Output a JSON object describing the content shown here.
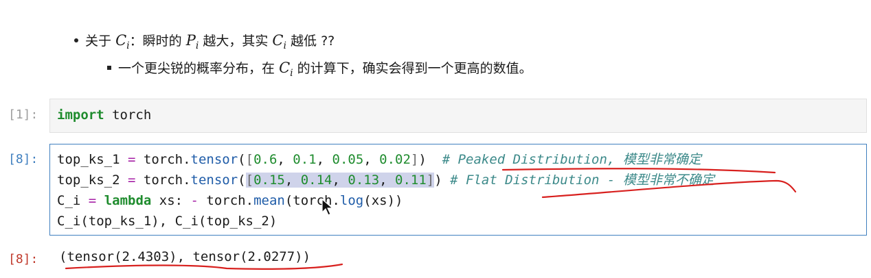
{
  "markdown": {
    "bullet1": {
      "prefix": "关于",
      "sep": "：瞬时的",
      "mid": "越大，其实",
      "suffix": "越低 ??"
    },
    "bullet2": {
      "prefix": "一个更尖锐的概率分布，在",
      "suffix": "的计算下，确实会得到一个更高的数值。"
    },
    "symbols": {
      "C": "C",
      "P": "P",
      "i": "i"
    }
  },
  "cells": [
    {
      "prompt": "[1]:",
      "code": {
        "kw": "import",
        "rest": " torch"
      }
    },
    {
      "prompt": "[8]:",
      "lines": {
        "l1": {
          "var": "top_ks_1",
          "eq": "=",
          "mod": "torch.",
          "fn": "tensor",
          "open": "(",
          "lb": "[",
          "n1": "0.6",
          "c1": ", ",
          "n2": "0.1",
          "c2": ", ",
          "n3": "0.05",
          "c3": ", ",
          "n4": "0.02",
          "rb": "]",
          "close": ")",
          "comment": "# Peaked Distribution, 模型非常确定"
        },
        "l2": {
          "var": "top_ks_2",
          "eq": "=",
          "mod": "torch.",
          "fn": "tensor",
          "open": "(",
          "lb": "[",
          "n1": "0.15",
          "c1": ", ",
          "n2": "0.14",
          "c2": ", ",
          "n3": "0.13",
          "c3": ", ",
          "n4": "0.11",
          "rb": "]",
          "close": ")",
          "comment": "# Flat Distribution - 模型非常不确定"
        },
        "l3": {
          "var": "C_i",
          "eq": "=",
          "kw": "lambda",
          "args": " xs: ",
          "minus": "-",
          "mod": " torch.",
          "fn": "mean",
          "open": "(",
          "mod2": "torch.",
          "fn2": "log",
          "inner": "(xs))"
        },
        "l4": {
          "text": "C_i(top_ks_1), C_i(top_ks_2)"
        }
      }
    }
  ],
  "output": {
    "prompt": "[8]:",
    "text": "(tensor(2.4303), tensor(2.0277))"
  },
  "colors": {
    "annotation_red": "#d8201e",
    "active_cell_border": "#3f7fbf"
  }
}
